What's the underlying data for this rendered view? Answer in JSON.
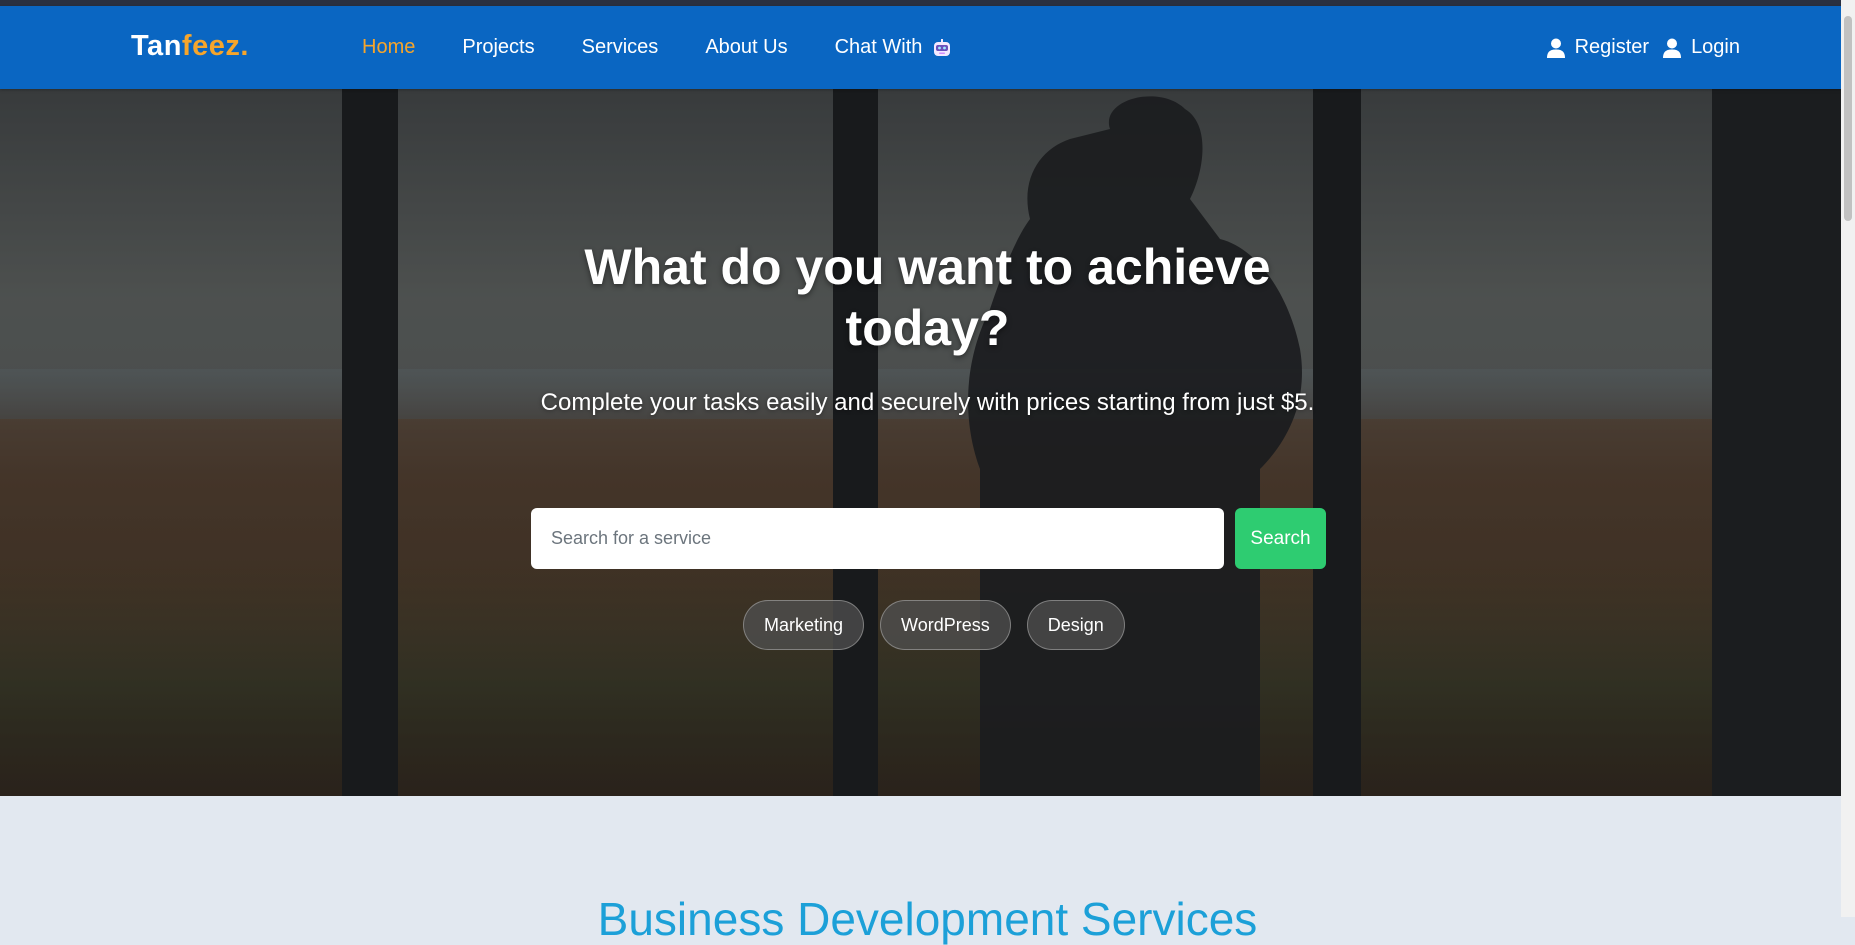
{
  "navbar": {
    "logo_part1": "Tan",
    "logo_part2": "feez.",
    "links": [
      "Home",
      "Projects",
      "Services",
      "About Us",
      "Chat With"
    ],
    "active_link": "Home",
    "register_label": "Register",
    "login_label": "Login"
  },
  "hero": {
    "title": "What do you want to achieve today?",
    "subtitle": "Complete your tasks easily and securely with prices starting from just $5.",
    "search_placeholder": "Search for a service",
    "search_button": "Search",
    "tags": [
      "Marketing",
      "WordPress",
      "Design"
    ]
  },
  "next_section": {
    "title": "Business Development Services"
  },
  "colors": {
    "navbar": "#0a66c2",
    "accent": "#f6a52b",
    "search_button": "#2ecc71",
    "section_title": "#1ca0d8",
    "section_bg": "#e2e8f0"
  },
  "icons": [
    "user-icon",
    "bot-icon"
  ]
}
